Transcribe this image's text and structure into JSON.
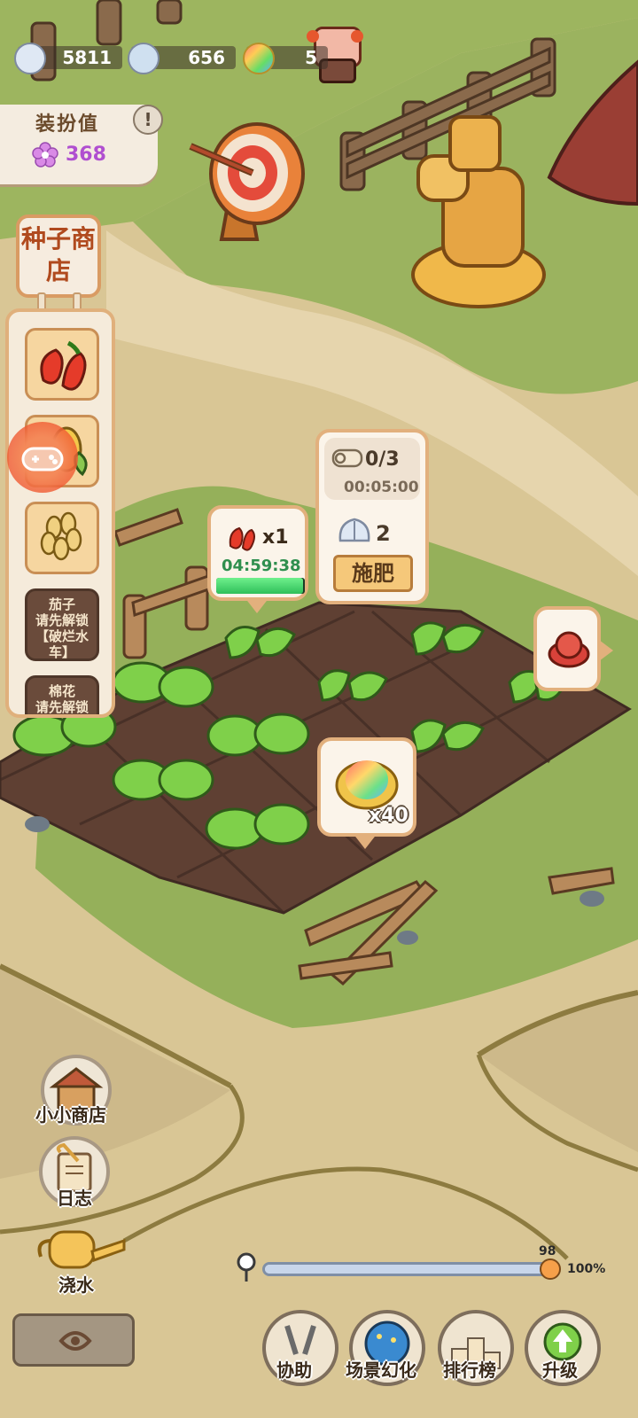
{
  "resources": [
    {
      "icon": "feather-icon",
      "value": "5811"
    },
    {
      "icon": "shell-icon",
      "value": "656"
    },
    {
      "icon": "rainbow-shell-icon",
      "value": "5"
    }
  ],
  "dress_value": {
    "title": "装扮值",
    "value": "368",
    "help": "!"
  },
  "seed_shop": {
    "title": "种子商店",
    "items": [
      {
        "name": "chili-seed",
        "locked": false
      },
      {
        "name": "corn-seed",
        "locked": false
      },
      {
        "name": "wheat-seed",
        "locked": false
      },
      {
        "name": "eggplant",
        "locked": true,
        "text": "茄子\n请先解锁\n【破烂水车】"
      },
      {
        "name": "cotton",
        "locked": true,
        "text": "棉花\n请先解锁"
      }
    ]
  },
  "crop_bubble": {
    "count": "x1",
    "timer": "04:59:38",
    "progress": 0.98
  },
  "fertilize_bubble": {
    "uses": "0/3",
    "timer": "00:05:00",
    "cost": "2",
    "button": "施肥"
  },
  "reward_bubble": {
    "count": "x40"
  },
  "left_buttons": {
    "shop": "小小商店",
    "log": "日志",
    "water": "浇水"
  },
  "zoom": {
    "value_top": "98",
    "percent": "100%",
    "level": 0.98
  },
  "bottom_nav": [
    {
      "label": "协助"
    },
    {
      "label": "场景幻化"
    },
    {
      "label": "排行榜"
    },
    {
      "label": "升级"
    }
  ],
  "colors": {
    "grass": "#98b25c",
    "path": "#dac89a",
    "soil": "#6b4a3a",
    "accent": "#e2b07d"
  }
}
